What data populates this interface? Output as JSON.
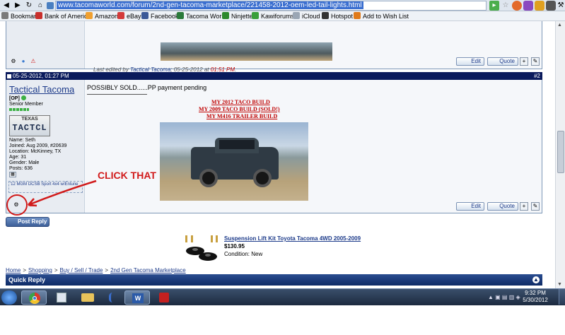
{
  "browser": {
    "url": "www.tacomaworld.com/forum/2nd-gen-tacoma-marketplace/221458-2012-oem-led-tail-lights.html",
    "star_icon": "☆",
    "wrench_icon": "⚒"
  },
  "bookmarks": [
    {
      "label": "Bookmarks",
      "color": "#7a7a7a"
    },
    {
      "label": "Bank of America",
      "color": "#c9302c"
    },
    {
      "label": "Amazon",
      "color": "#f0a030"
    },
    {
      "label": "eBay",
      "color": "#d43a3a"
    },
    {
      "label": "Facebook",
      "color": "#3b5998"
    },
    {
      "label": "Tacoma World",
      "color": "#2a7a3a"
    },
    {
      "label": "Ninjette",
      "color": "#2d8a2d"
    },
    {
      "label": "Kawiforums",
      "color": "#3aa03a"
    },
    {
      "label": "iCloud",
      "color": "#9aa6b4"
    },
    {
      "label": "Hotspot",
      "color": "#333333"
    },
    {
      "label": "Add to Wish List",
      "color": "#e07a1a"
    }
  ],
  "post1": {
    "edited_prefix": "Last edited by",
    "edited_user": "Tactical Tacoma",
    "edited_mid": "; 05-25-2012 at",
    "edited_time": "01:51 PM",
    "edited_suffix": "."
  },
  "post2": {
    "datetime": "05-25-2012, 01:27 PM",
    "number": "#2",
    "username": "Tactical Tacoma",
    "op_tag": "[OP]",
    "rank": "Senior Member",
    "plate_state": "TEXAS",
    "plate_number": "TACTCL",
    "name": "Name: Seth",
    "joined": "Joined: Aug 2009, #20639",
    "location": "Location: McKinney, TX",
    "age": "Age: 31",
    "gender": "Gender: Male",
    "posts": "Posts: 636",
    "signature": "'12 MGM DCSB Sport 4x4 w/Entune",
    "message": "POSSIBLY SOLD......PP payment pending",
    "links": [
      "MY 2012 TACO BUILD",
      "MY 2009 TACO BUILD (SOLD!)",
      "MY M416 TRAILER BUILD"
    ]
  },
  "buttons": {
    "edit": "Edit",
    "quote": "Quote",
    "post_reply": "Post Reply"
  },
  "annotation": "CLICK THAT",
  "ad": {
    "title": "Suspension Lift Kit Toyota Tacoma 4WD 2005-2009",
    "price": "$130.95",
    "condition": "Condition: New"
  },
  "breadcrumbs": [
    "Home",
    "Shopping",
    "Buy / Sell / Trade",
    "2nd Gen Tacoma Marketplace"
  ],
  "quick_reply": "Quick Reply",
  "clock": {
    "time": "9:32 PM",
    "date": "5/30/2012"
  },
  "colors": {
    "accent": "#0a1a5c",
    "annotation": "#d11a1a"
  }
}
